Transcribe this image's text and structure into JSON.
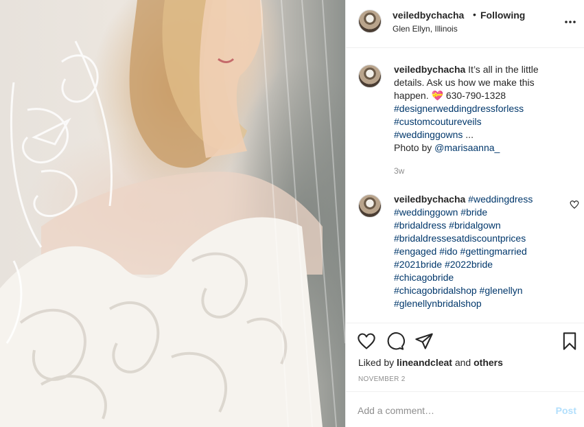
{
  "post": {
    "username": "veiledbychacha",
    "separator": "•",
    "follow_status": "Following",
    "location": "Glen Ellyn, Illinois",
    "more_icon": "more-horizontal-icon"
  },
  "caption": {
    "username": "veiledbychacha",
    "text_1": " It’s all in the little details. Ask us how we make this happen. ",
    "emoji": "💝",
    "phone": " 630-790-1328",
    "tags": [
      "#designerweddingdressforless",
      "#customcoutureveils",
      "#weddinggowns"
    ],
    "ellipsis": " ...",
    "photo_by": "Photo by ",
    "photo_credit": "@marisaanna_",
    "time": "3w"
  },
  "comment": {
    "username": "veiledbychacha",
    "tags": [
      "#weddingdress",
      "#weddinggown",
      "#bride",
      "#bridaldress",
      "#bridalgown",
      "#bridaldressesatdiscountprices",
      "#engaged",
      "#ido",
      "#gettingmarried",
      "#2021bride",
      "#2022bride",
      "#chicagobride",
      "#chicagobridalshop",
      "#glenellyn",
      "#glenellynbridalshop"
    ]
  },
  "actions": {
    "like_icon": "heart-icon",
    "comment_icon": "comment-icon",
    "share_icon": "paper-plane-icon",
    "save_icon": "bookmark-icon"
  },
  "likes": {
    "prefix": "Liked by ",
    "user": "lineandcleat",
    "middle": " and ",
    "others": "others"
  },
  "date": "NOVEMBER 2",
  "add_comment": {
    "placeholder": "Add a comment…",
    "post_label": "Post"
  },
  "colors": {
    "hashtag": "#00376b",
    "muted": "#8e8e8e",
    "post_disabled": "#b2dffc"
  }
}
